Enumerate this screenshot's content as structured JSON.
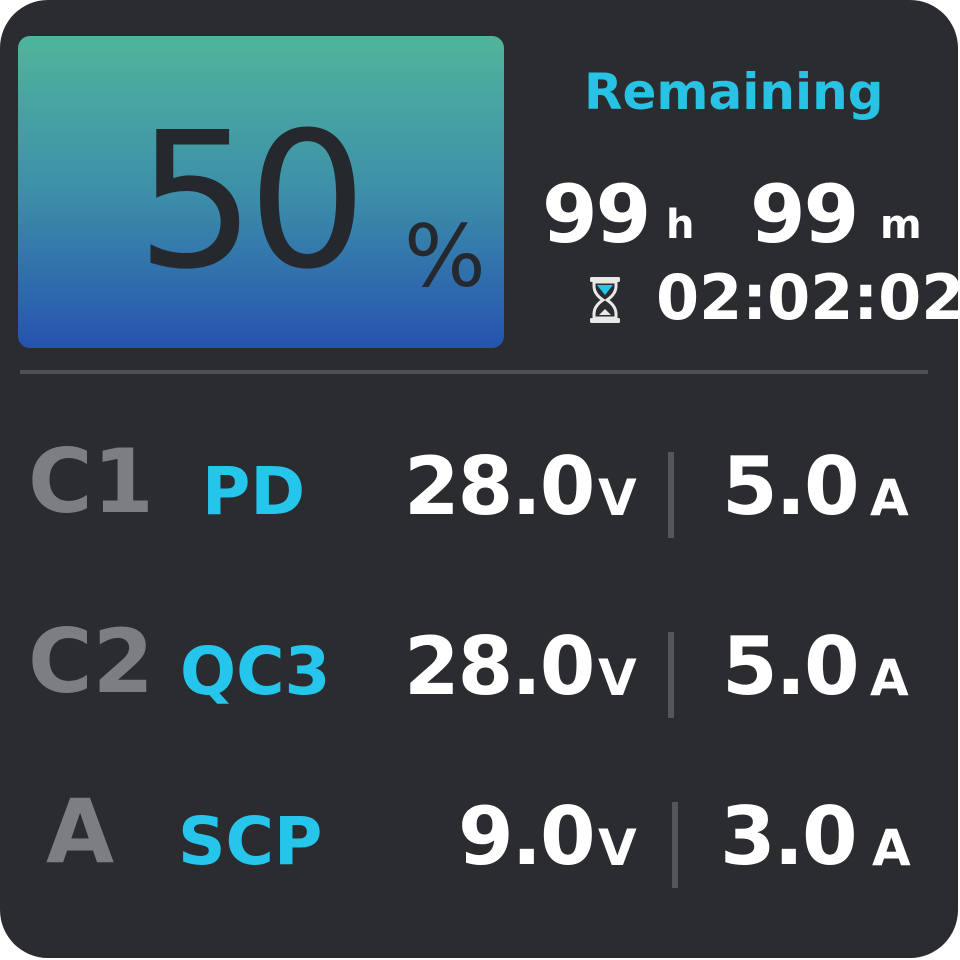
{
  "battery": {
    "level": 50,
    "value": "50",
    "unit": "%"
  },
  "remaining": {
    "label": "Remaining",
    "hours": "99",
    "hours_unit": "h",
    "minutes": "99",
    "minutes_unit": "m",
    "timer": "02:02:02",
    "timer_icon": "hourglass-icon"
  },
  "ports": [
    {
      "name": "C1",
      "protocol": "PD",
      "voltage": "28.0",
      "voltage_unit": "V",
      "current": "5.0",
      "current_unit": "A"
    },
    {
      "name": "C2",
      "protocol": "QC3",
      "voltage": "28.0",
      "voltage_unit": "V",
      "current": "5.0",
      "current_unit": "A"
    },
    {
      "name": "A",
      "protocol": "SCP",
      "voltage": "9.0",
      "voltage_unit": "V",
      "current": "3.0",
      "current_unit": "A"
    }
  ],
  "colors": {
    "background": "#2a2c30",
    "accent": "#26c6ec",
    "port_label": "#7d7e82",
    "tile_gradient_top": "#4fb59b",
    "tile_gradient_bottom": "#2553b0"
  }
}
